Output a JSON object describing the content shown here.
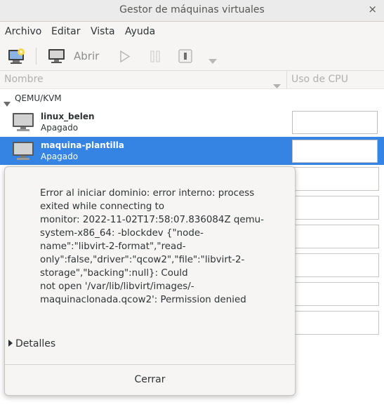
{
  "window": {
    "title": "Gestor de máquinas virtuales",
    "close_glyph": "×"
  },
  "menu": {
    "items": [
      "Archivo",
      "Editar",
      "Vista",
      "Ayuda"
    ]
  },
  "toolbar": {
    "open_label": "Abrir"
  },
  "columns": {
    "name": "Nombre",
    "cpu": "Uso de CPU"
  },
  "group": {
    "label": "QEMU/KVM"
  },
  "vms": [
    {
      "name": "linux_belen",
      "state": "Apagado",
      "selected": false
    },
    {
      "name": "maquina-plantilla",
      "state": "Apagado",
      "selected": true
    }
  ],
  "dialog": {
    "message": "Error al iniciar dominio: error interno: process\nexited while connecting to\nmonitor: 2022-11-02T17:58:07.836084Z qemu-\nsystem-x86_64: -blockdev {\"node-\nname\":\"libvirt-2-format\",\"read-\nonly\":false,\"driver\":\"qcow2\",\"file\":\"libvirt-2-\nstorage\",\"backing\":null}: Could\nnot open '/var/lib/libvirt/images/-\nmaquinaclonada.qcow2': Permission denied",
    "details_label": "Detalles",
    "close_label": "Cerrar"
  },
  "colors": {
    "selection": "#3584e4",
    "titlebar": "#ebebeb"
  }
}
